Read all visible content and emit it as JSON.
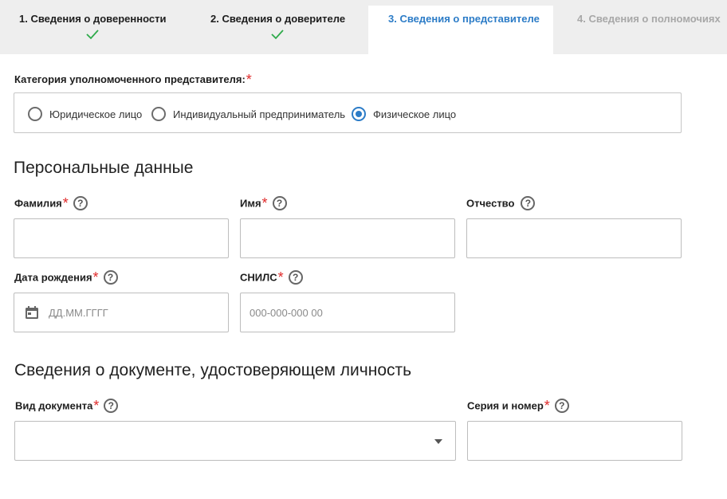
{
  "tabs": [
    {
      "label": "1. Сведения о доверенности",
      "state": "done"
    },
    {
      "label": "2. Сведения о доверителе",
      "state": "done"
    },
    {
      "label": "3. Сведения о представителе",
      "state": "active"
    },
    {
      "label": "4. Сведения о полномочиях",
      "state": "disabled"
    }
  ],
  "category": {
    "label": "Категория уполномоченного представителя:",
    "required_mark": "*",
    "options": [
      {
        "label": "Юридическое лицо",
        "checked": false
      },
      {
        "label": "Индивидуальный предприниматель",
        "checked": false
      },
      {
        "label": "Физическое лицо",
        "checked": true
      }
    ]
  },
  "personal": {
    "title": "Персональные данные",
    "surname": {
      "label": "Фамилия",
      "required_mark": "*",
      "help": "?",
      "value": ""
    },
    "name": {
      "label": "Имя",
      "required_mark": "*",
      "help": "?",
      "value": ""
    },
    "patronymic": {
      "label": "Отчество",
      "help": "?",
      "value": ""
    },
    "birthdate": {
      "label": "Дата рождения",
      "required_mark": "*",
      "help": "?",
      "placeholder": "ДД.ММ.ГГГГ",
      "icon": "calendar-icon"
    },
    "snils": {
      "label": "СНИЛС",
      "required_mark": "*",
      "help": "?",
      "placeholder": "000-000-000 00"
    }
  },
  "document": {
    "title": "Сведения о документе, удостоверяющем личность",
    "type": {
      "label": "Вид документа",
      "required_mark": "*",
      "help": "?",
      "value": ""
    },
    "series_number": {
      "label": "Серия и номер",
      "required_mark": "*",
      "help": "?",
      "value": ""
    }
  },
  "colors": {
    "accent": "#2c7cc7",
    "success": "#2eaa4a",
    "required": "#e02a2a",
    "tab_bg": "#eeeeee"
  }
}
